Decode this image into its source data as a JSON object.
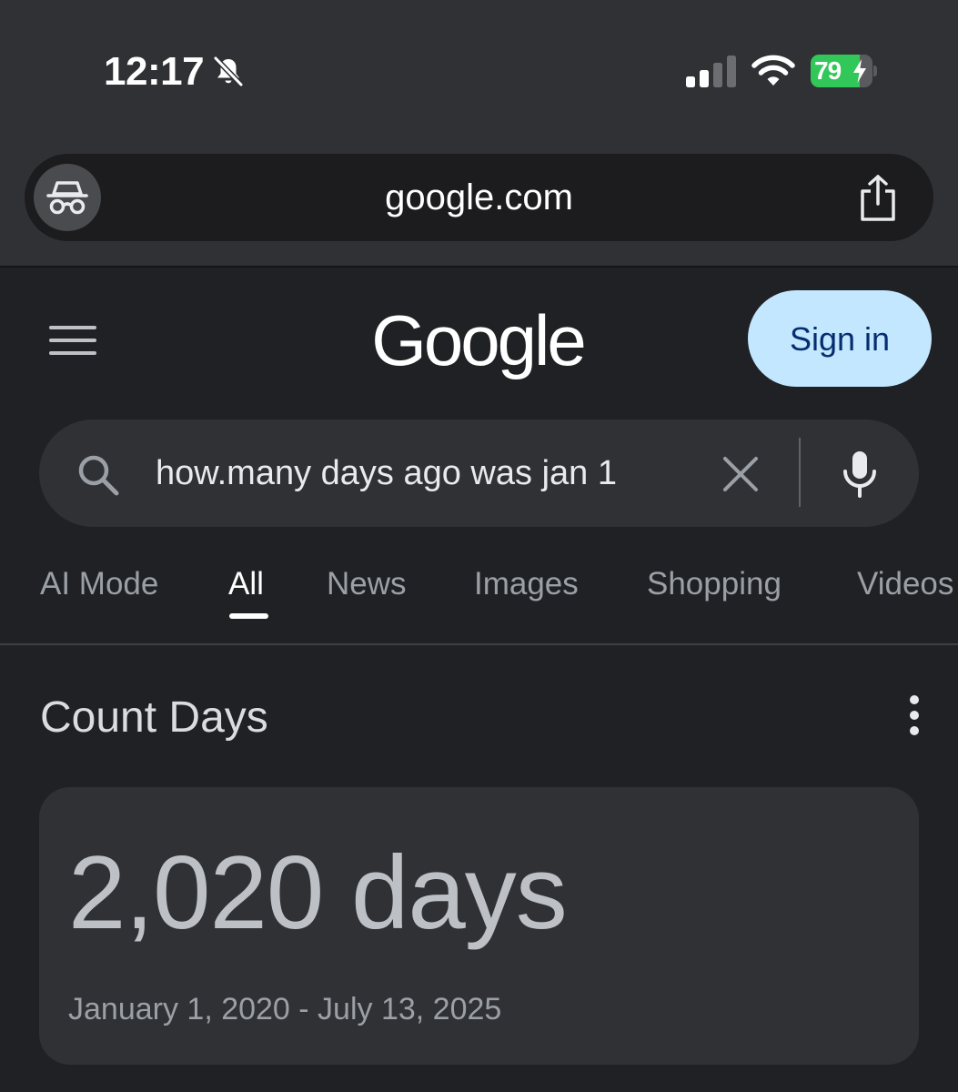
{
  "status_bar": {
    "time": "12:17",
    "battery_percent": "79",
    "battery_level": 0.79,
    "signal_bars_active": 2,
    "icons": [
      "bell-slash-icon",
      "cellular-signal-icon",
      "wifi-icon",
      "battery-charging-icon"
    ]
  },
  "browser": {
    "url": "google.com",
    "icons": [
      "incognito-icon",
      "share-icon"
    ]
  },
  "header": {
    "logo_text": "Google",
    "sign_in_label": "Sign in",
    "icons": [
      "menu-icon"
    ]
  },
  "search": {
    "query": "how.many days ago was jan 1",
    "icons": [
      "search-icon",
      "clear-icon",
      "microphone-icon"
    ]
  },
  "tabs": [
    {
      "label": "AI Mode",
      "active": false
    },
    {
      "label": "All",
      "active": true
    },
    {
      "label": "News",
      "active": false
    },
    {
      "label": "Images",
      "active": false
    },
    {
      "label": "Shopping",
      "active": false
    },
    {
      "label": "Videos",
      "active": false
    }
  ],
  "result": {
    "title": "Count Days",
    "value": "2,020 days",
    "range": "January 1, 2020 - July 13, 2025",
    "icons": [
      "more-vert-icon"
    ]
  },
  "colors": {
    "page_background": "#202124",
    "chrome_background": "#303134",
    "sign_in_background": "#c2e7ff",
    "sign_in_text": "#062e6f",
    "battery_green": "#32c759"
  }
}
